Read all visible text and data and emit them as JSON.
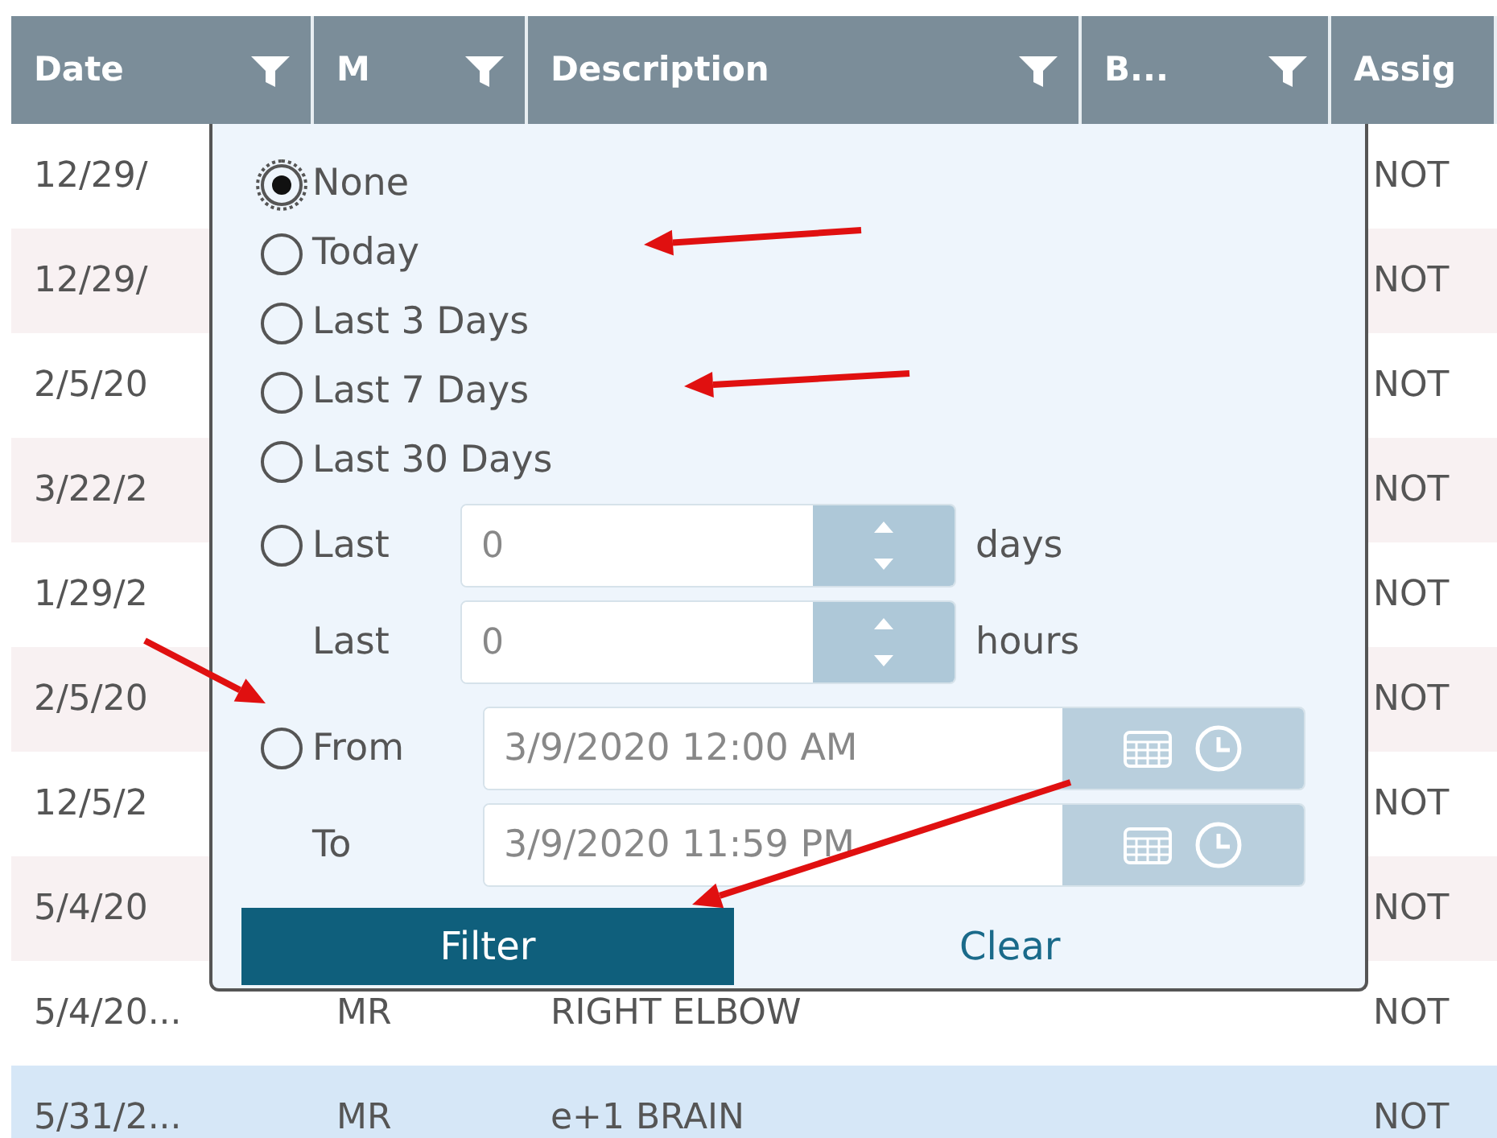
{
  "table": {
    "columns": [
      {
        "label": "Date",
        "filterable": true
      },
      {
        "label": "M",
        "filterable": true
      },
      {
        "label": "Description",
        "filterable": true
      },
      {
        "label": "B...",
        "filterable": true
      },
      {
        "label": "Assig",
        "filterable": false
      }
    ],
    "rows": [
      {
        "date": "12/29/",
        "assigned": "NOT",
        "selected": false
      },
      {
        "date": "12/29/",
        "assigned": "NOT",
        "selected": false
      },
      {
        "date": "2/5/20",
        "assigned": "NOT",
        "selected": false
      },
      {
        "date": "3/22/2",
        "assigned": "NOT",
        "selected": false
      },
      {
        "date": "1/29/2",
        "assigned": "NOT",
        "selected": false
      },
      {
        "date": "2/5/20",
        "assigned": "NOT",
        "selected": false
      },
      {
        "date": "12/5/2",
        "assigned": "NOT",
        "selected": false
      },
      {
        "date": "5/4/20",
        "assigned": "NOT",
        "selected": false
      },
      {
        "date": "5/4/20...",
        "m": "MR",
        "description": "RIGHT ELBOW",
        "assigned": "NOT",
        "selected": false
      },
      {
        "date": "5/31/2...",
        "m": "MR",
        "description": "e+1 BRAIN",
        "assigned": "NOT",
        "selected": true
      }
    ]
  },
  "filter_popup": {
    "presets": [
      {
        "label": "None",
        "selected": true
      },
      {
        "label": "Today",
        "selected": false
      },
      {
        "label": "Last 3 Days",
        "selected": false
      },
      {
        "label": "Last 7 Days",
        "selected": false
      },
      {
        "label": "Last 30 Days",
        "selected": false
      }
    ],
    "last": {
      "label": "Last",
      "selected": false,
      "value": "0",
      "unit": "days"
    },
    "last_hours": {
      "label": "Last",
      "value": "0",
      "unit": "hours"
    },
    "range": {
      "label": "From",
      "selected": false,
      "from": "3/9/2020 12:00 AM",
      "to_label": "To",
      "to": "3/9/2020 11:59 PM"
    },
    "filter_button": "Filter",
    "clear_link": "Clear"
  }
}
